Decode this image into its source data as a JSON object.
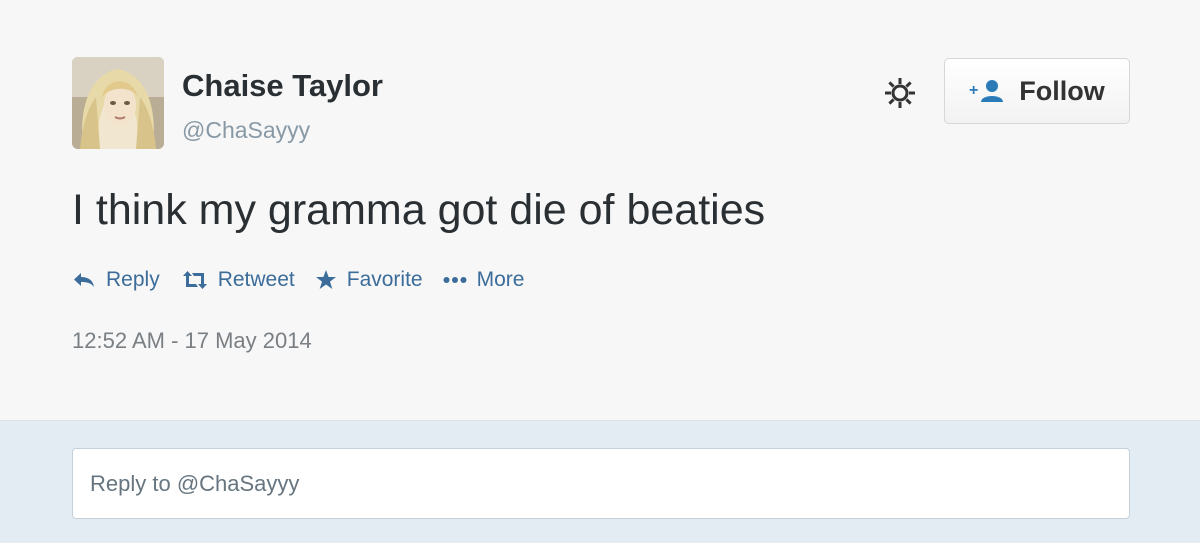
{
  "tweet": {
    "author": {
      "name": "Chaise Taylor",
      "handle": "@ChaSayyy",
      "avatar_icon": "profile-photo"
    },
    "text": "I think my gramma got die of beaties",
    "timestamp": "12:52 AM - 17 May 2014"
  },
  "header": {
    "settings_icon": "gear-icon",
    "follow": {
      "icon": "add-user-icon",
      "label": "Follow"
    }
  },
  "actions": {
    "reply": {
      "icon": "reply-arrow-icon",
      "label": "Reply"
    },
    "retweet": {
      "icon": "retweet-icon",
      "label": "Retweet"
    },
    "favorite": {
      "icon": "star-icon",
      "label": "Favorite"
    },
    "more": {
      "icon": "ellipsis-icon",
      "label": "More"
    }
  },
  "reply_box": {
    "placeholder": "Reply to @ChaSayyy"
  },
  "colors": {
    "action_blue": "#3b6c9a",
    "name_text": "#292f33",
    "muted_text": "#8899a6",
    "reply_area_bg": "#e4ecf3"
  }
}
